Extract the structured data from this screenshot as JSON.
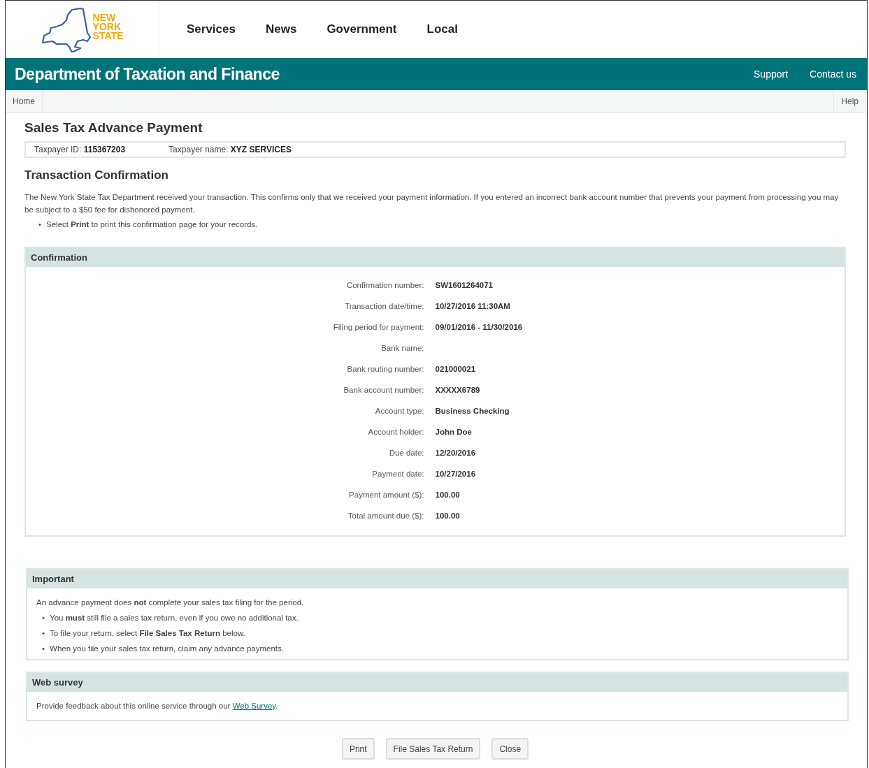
{
  "logo": {
    "lines": [
      "NEW",
      "YORK",
      "STATE"
    ]
  },
  "nav": [
    "Services",
    "News",
    "Government",
    "Local"
  ],
  "department": {
    "title": "Department of Taxation and Finance",
    "links": [
      "Support",
      "Contact us"
    ]
  },
  "breadcrumb": {
    "home": "Home",
    "help": "Help"
  },
  "page_title": "Sales Tax Advance Payment",
  "taxpayer": [
    {
      "label": "Taxpayer ID:",
      "value": "115367203"
    },
    {
      "label": "Taxpayer name:",
      "value": "XYZ SERVICES"
    }
  ],
  "section_title": "Transaction Confirmation",
  "intro": "The New York State Tax Department received your transaction. This confirms only that we received your payment information. If you entered an incorrect bank account number that prevents your payment from processing you may be subject to a $50 fee for dishonored payment.",
  "bullet": "•",
  "intro_bullets": [
    "Select **Print** to print this confirmation page for your records."
  ],
  "confirmation": {
    "title": "Confirmation",
    "rows": [
      {
        "label": "Confirmation number:",
        "value": "SW1601264071"
      },
      {
        "label": "Transaction date/time:",
        "value": "10/27/2016 11:30AM"
      },
      {
        "label": "Filing period for payment:",
        "value": "09/01/2016 - 11/30/2016"
      },
      {
        "label": "Bank name:"
      },
      {
        "label": "Bank routing number:",
        "value": "021000021"
      },
      {
        "label": "Bank account number:",
        "value": "XXXXX6789"
      },
      {
        "label": "Account type:",
        "value": "Business Checking"
      },
      {
        "label": "Account holder:",
        "value": "John Doe"
      },
      {
        "label": "Due date:",
        "value": "12/20/2016"
      },
      {
        "label": "Payment date:",
        "value": "10/27/2016"
      },
      {
        "label": "Payment amount ($):",
        "value": "100.00"
      },
      {
        "label": "Total amount due ($):",
        "value": "100.00"
      }
    ]
  },
  "important": {
    "title": "Important",
    "text": "An advance payment does **not** complete your sales tax filing for the period.",
    "bullets": [
      "You **must** still file a sales tax return, even if you owe no additional tax.",
      "To file your return, select **File Sales Tax Return** below.",
      "When you file your sales tax return, claim any advance payments."
    ]
  },
  "web_survey": {
    "title": "Web survey",
    "text": "Provide feedback about this online service through our",
    "link": "Web Survey",
    "after": "."
  },
  "buttons": [
    "Print",
    "File Sales Tax Return",
    "Close"
  ]
}
